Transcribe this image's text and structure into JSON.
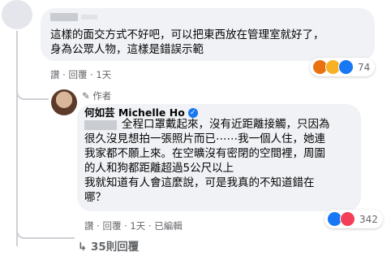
{
  "comment1": {
    "text_line1": "這樣的面交方式不好吧，可以把東西放在管理室就好了，",
    "text_line2": "身為公眾人物，這樣是錯誤示範",
    "actions": {
      "reply": "讚 · 回覆 · 1天"
    },
    "reactions": {
      "count": "74",
      "icons": [
        "angry-face",
        "laughing-face",
        "like-thumb"
      ]
    }
  },
  "reply1": {
    "author_badge": "作者",
    "author_name": "何如芸 Michelle Ho",
    "lines": [
      "全程口罩戴起來，沒有近距離接觸，只因為",
      "很久沒見想拍一張照片而已⋯⋯我一個人住，她連",
      "我家都不願上來。在空曠沒有密閉的空間裡，周圍",
      "的人和狗都距離超過5公尺以上",
      "我就知道有人會這麼說，可是我真的不知道錯在",
      "哪？"
    ],
    "actions": "讚 · 回覆 · 1天 · 已編輯",
    "reactions": {
      "count": "342",
      "icons": [
        "like-thumb",
        "heart"
      ]
    }
  },
  "more_replies": {
    "label": "35則回覆"
  },
  "colors": {
    "accent": "#1877f2",
    "bubble": "#f0f2f5",
    "muted": "#65676b"
  }
}
